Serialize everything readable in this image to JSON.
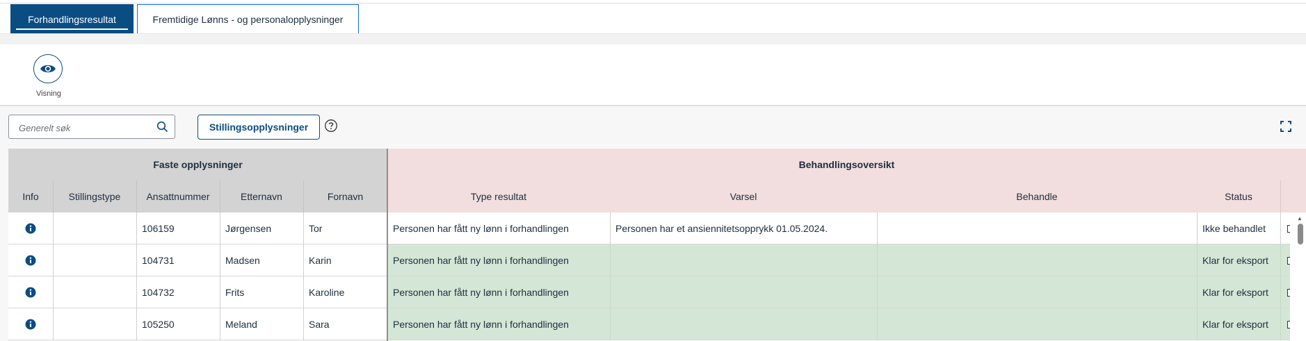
{
  "tabs": [
    {
      "label": "Forhandlingsresultat",
      "active": true
    },
    {
      "label": "Fremtidige Lønns - og personalopplysninger",
      "active": false
    }
  ],
  "toolbar": {
    "view_label": "Visning",
    "view_icon": "eye-icon"
  },
  "search": {
    "placeholder": "Generelt søk",
    "icon": "search-icon"
  },
  "stilling_button_label": "Stillingsopplysninger",
  "table": {
    "group_fixed": "Faste opplysninger",
    "group_processing": "Behandlingsoversikt",
    "columns": [
      "Info",
      "Stillingstype",
      "Ansattnummer",
      "Etternavn",
      "Fornavn",
      "Type resultat",
      "Varsel",
      "Behandle",
      "Status"
    ],
    "rows": [
      {
        "stillingstype": "",
        "ansattnummer": "106159",
        "etternavn": "Jørgensen",
        "fornavn": "Tor",
        "type_resultat": "Personen har fått ny lønn i forhandlingen",
        "varsel": "Personen har et ansiennitetsopprykk 01.05.2024.",
        "behandle": "",
        "status": "Ikke behandlet",
        "state": "white"
      },
      {
        "stillingstype": "",
        "ansattnummer": "104731",
        "etternavn": "Madsen",
        "fornavn": "Karin",
        "type_resultat": "Personen har fått ny lønn i forhandlingen",
        "varsel": "",
        "behandle": "",
        "status": "Klar for eksport",
        "state": "green"
      },
      {
        "stillingstype": "",
        "ansattnummer": "104732",
        "etternavn": "Frits",
        "fornavn": "Karoline",
        "type_resultat": "Personen har fått ny lønn i forhandlingen",
        "varsel": "",
        "behandle": "",
        "status": "Klar for eksport",
        "state": "green"
      },
      {
        "stillingstype": "",
        "ansattnummer": "105250",
        "etternavn": "Meland",
        "fornavn": "Sara",
        "type_resultat": "Personen har fått ny lønn i forhandlingen",
        "varsel": "",
        "behandle": "",
        "status": "Klar for eksport",
        "state": "green"
      }
    ]
  },
  "colors": {
    "brand": "#0a4d83",
    "header_fixed": "#d3d3d3",
    "header_processing": "#f2dede",
    "row_done": "#d4e6d6"
  }
}
